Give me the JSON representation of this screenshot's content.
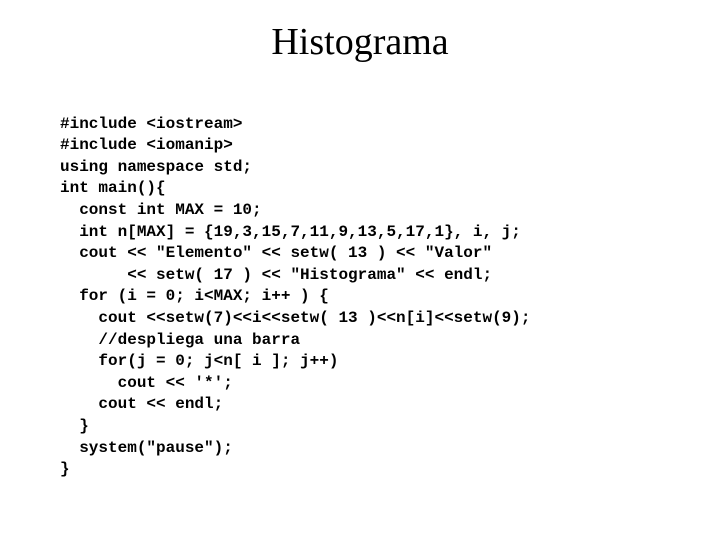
{
  "title": "Histograma",
  "code": {
    "l01": "#include <iostream>",
    "l02": "#include <iomanip>",
    "l03": "using namespace std;",
    "l04": "int main(){",
    "l05": "  const int MAX = 10;",
    "l06": "  int n[MAX] = {19,3,15,7,11,9,13,5,17,1}, i, j;",
    "l07": "  cout << \"Elemento\" << setw( 13 ) << \"Valor\"",
    "l08": "       << setw( 17 ) << \"Histograma\" << endl;",
    "l09": "  for (i = 0; i<MAX; i++ ) {",
    "l10": "    cout <<setw(7)<<i<<setw( 13 )<<n[i]<<setw(9);",
    "l11": "    //despliega una barra",
    "l12": "    for(j = 0; j<n[ i ]; j++)",
    "l13": "      cout << '*';",
    "l14": "    cout << endl;",
    "l15": "  }",
    "l16": "  system(\"pause\");",
    "l17": "}"
  }
}
